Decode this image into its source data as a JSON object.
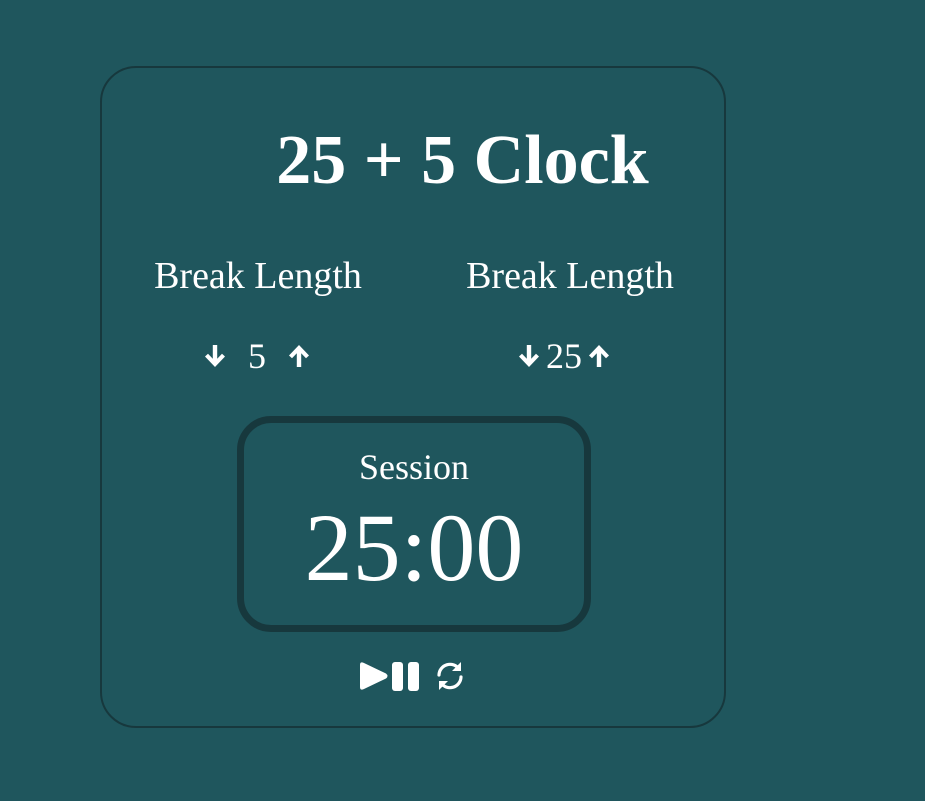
{
  "title": "25 + 5 Clock",
  "break": {
    "label": "Break Length",
    "value": "5"
  },
  "session": {
    "label": "Break Length",
    "value": "25"
  },
  "timer": {
    "label": "Session",
    "time_left": "25:00"
  },
  "icons": {
    "decrement": "arrow-down-icon",
    "increment": "arrow-up-icon",
    "play": "play-icon",
    "pause": "pause-icon",
    "reset": "refresh-icon"
  },
  "colors": {
    "background": "#1f565d",
    "border": "#17383d",
    "text": "#ffffff"
  }
}
